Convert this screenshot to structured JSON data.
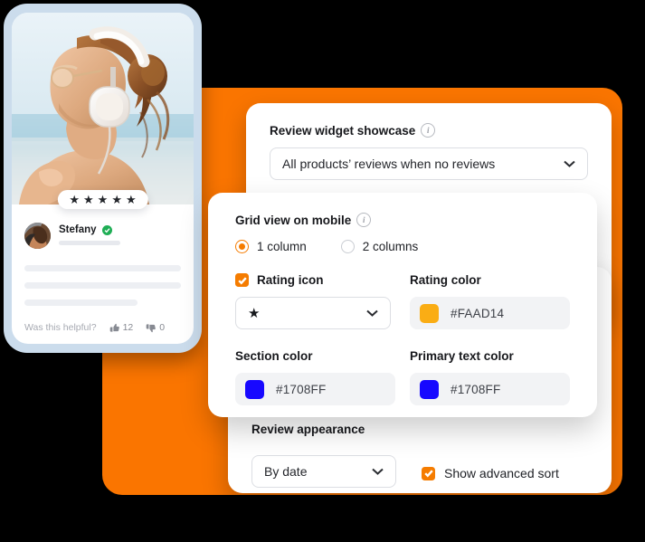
{
  "colors": {
    "orange_panel": "#FA7500",
    "accent": "#F57C00",
    "phone_frame": "#CBDCEC",
    "verified_green": "#1FAE55"
  },
  "phone_preview": {
    "stars_count": 5,
    "star_glyph": "★",
    "reviewer_name": "Stefany",
    "verified": true,
    "helpful_question": "Was this helpful?",
    "upvotes": "12",
    "downvotes": "0"
  },
  "showcase_card": {
    "label": "Review widget showcase",
    "info_icon": "info-icon",
    "select_value": "All products’ reviews when no reviews",
    "chevron": "chevron-down-icon"
  },
  "grid_card": {
    "label": "Grid view on mobile",
    "info_icon": "info-icon",
    "radios": [
      {
        "label": "1 column",
        "selected": true
      },
      {
        "label": "2 columns",
        "selected": false
      }
    ],
    "rating_icon": {
      "label": "Rating icon",
      "checked": true,
      "select_value": "★",
      "chevron": "chevron-down-icon"
    },
    "rating_color": {
      "label": "Rating color",
      "value": "#FAAD14",
      "swatch": "#FAAD14"
    },
    "section_color": {
      "label": "Section color",
      "value": "#1708FF",
      "swatch": "#1708FF"
    },
    "primary_text_color": {
      "label": "Primary text color",
      "value": "#1708FF",
      "swatch": "#1708FF"
    }
  },
  "appearance_card": {
    "label": "Review appearance",
    "select_value": "By date",
    "chevron": "chevron-down-icon",
    "advanced_sort": {
      "label": "Show advanced sort",
      "checked": true
    }
  }
}
